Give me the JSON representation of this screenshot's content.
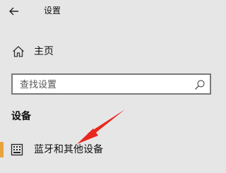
{
  "window": {
    "title": "设置"
  },
  "nav": {
    "back_icon": "back-arrow-icon",
    "home": {
      "label": "主页",
      "icon": "home-icon"
    }
  },
  "search": {
    "placeholder": "查找设置",
    "value": "",
    "icon": "search-icon"
  },
  "section": {
    "header": "设备",
    "items": [
      {
        "label": "蓝牙和其他设备",
        "icon": "keyboard-icon",
        "selected": true
      }
    ]
  },
  "colors": {
    "background": "#e6e6e6",
    "accent": "#e8a33d",
    "annotation_arrow": "#e8281e",
    "search_border": "#7a7a7a"
  }
}
